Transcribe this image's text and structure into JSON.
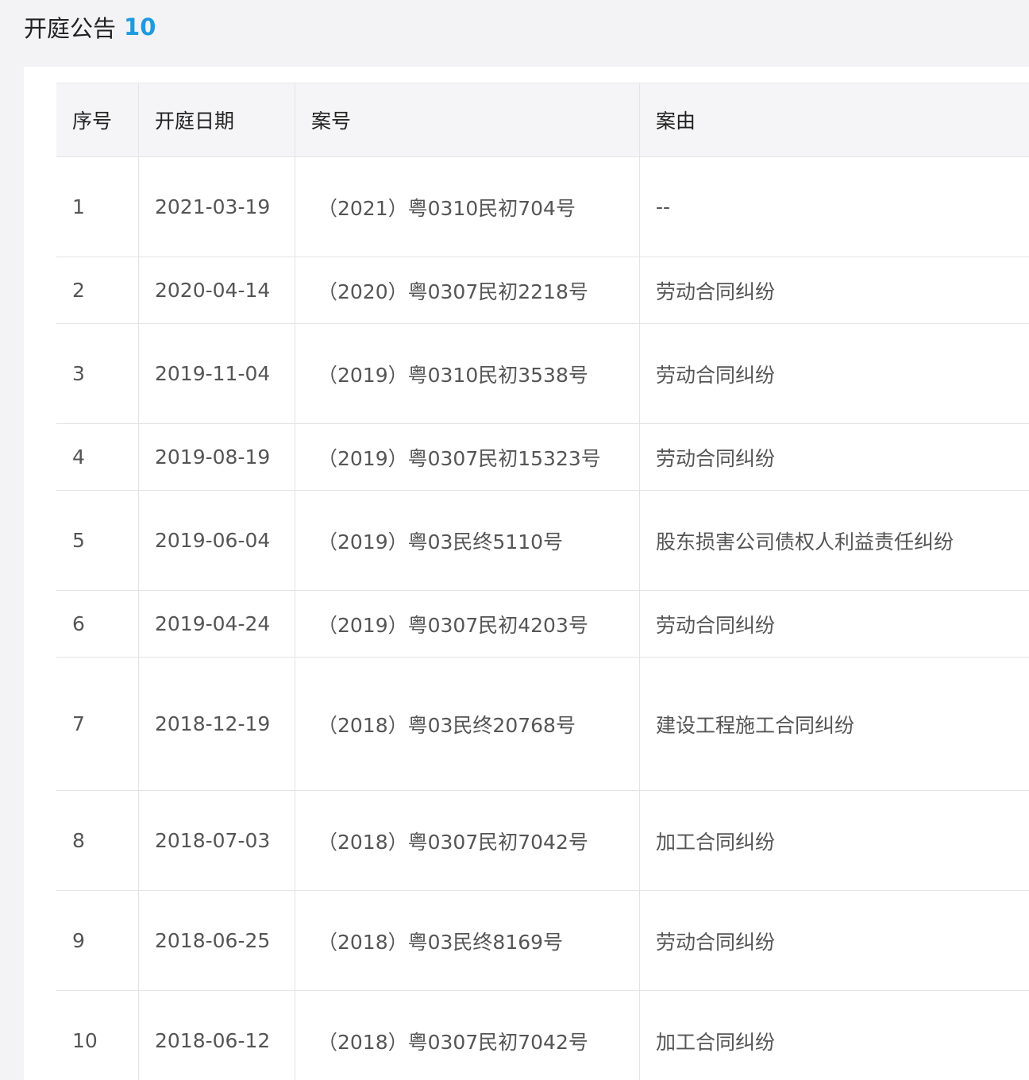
{
  "header": {
    "title": "开庭公告",
    "count": "10"
  },
  "table": {
    "columns": [
      "序号",
      "开庭日期",
      "案号",
      "案由"
    ],
    "rows": [
      {
        "index": "1",
        "date": "2021-03-19",
        "case_no": "（2021）粤0310民初704号",
        "cause": "--"
      },
      {
        "index": "2",
        "date": "2020-04-14",
        "case_no": "（2020）粤0307民初2218号",
        "cause": "劳动合同纠纷"
      },
      {
        "index": "3",
        "date": "2019-11-04",
        "case_no": "（2019）粤0310民初3538号",
        "cause": "劳动合同纠纷"
      },
      {
        "index": "4",
        "date": "2019-08-19",
        "case_no": "（2019）粤0307民初15323号",
        "cause": "劳动合同纠纷"
      },
      {
        "index": "5",
        "date": "2019-06-04",
        "case_no": "（2019）粤03民终5110号",
        "cause": "股东损害公司债权人利益责任纠纷"
      },
      {
        "index": "6",
        "date": "2019-04-24",
        "case_no": "（2019）粤0307民初4203号",
        "cause": "劳动合同纠纷"
      },
      {
        "index": "7",
        "date": "2018-12-19",
        "case_no": "（2018）粤03民终20768号",
        "cause": "建设工程施工合同纠纷"
      },
      {
        "index": "8",
        "date": "2018-07-03",
        "case_no": "（2018）粤0307民初7042号",
        "cause": "加工合同纠纷"
      },
      {
        "index": "9",
        "date": "2018-06-25",
        "case_no": "（2018）粤03民终8169号",
        "cause": "劳动合同纠纷"
      },
      {
        "index": "10",
        "date": "2018-06-12",
        "case_no": "（2018）粤0307民初7042号",
        "cause": "加工合同纠纷"
      }
    ]
  }
}
